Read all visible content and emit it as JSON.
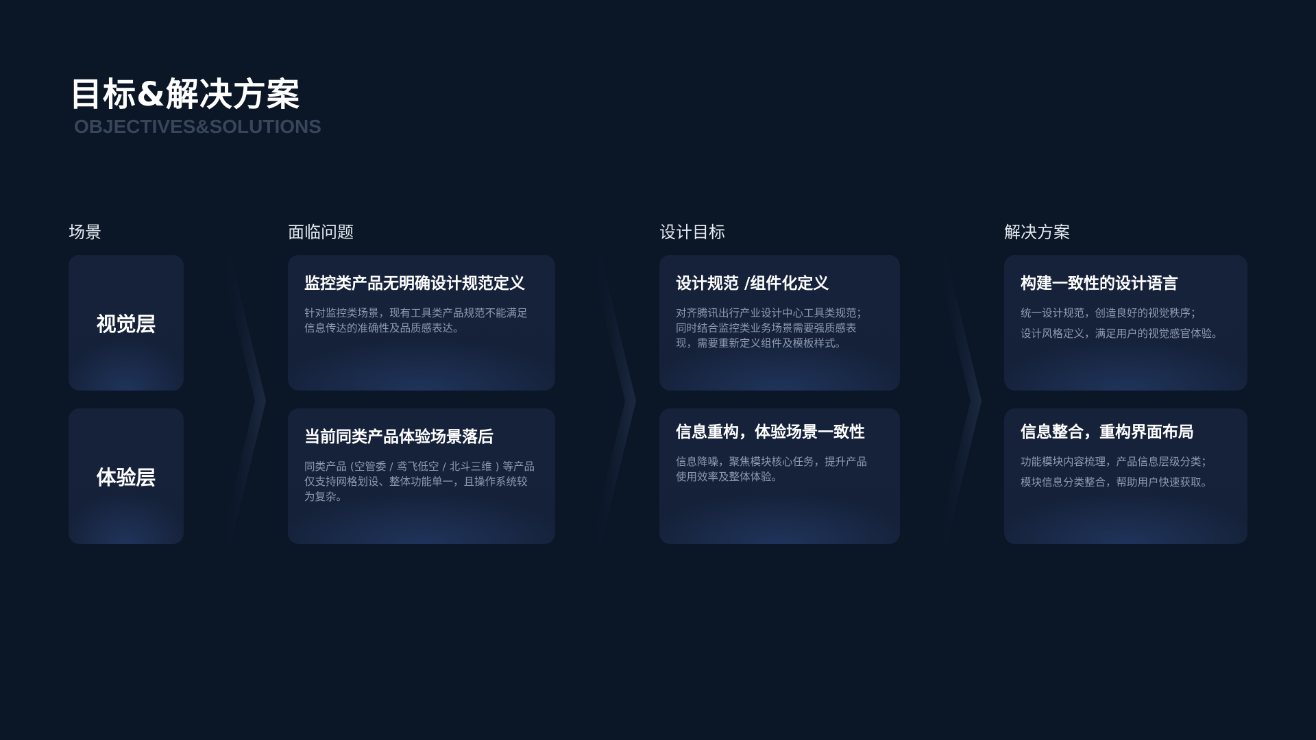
{
  "page": {
    "title": "目标&解决方案",
    "subtitle": "OBJECTIVES&SOLUTIONS"
  },
  "columns": {
    "scene": {
      "header": "场景",
      "items": [
        "视觉层",
        "体验层"
      ]
    },
    "problems": {
      "header": "面临问题",
      "cards": [
        {
          "title": "监控类产品无明确设计规范定义",
          "lines": [
            "针对监控类场景，现有工具类产品规范不能满足",
            "信息传达的准确性及品质感表达。"
          ]
        },
        {
          "title": "当前同类产品体验场景落后",
          "lines": [
            "同类产品 (空管委 / 鸢飞低空 / 北斗三维 ) 等产品",
            "仅支持网格划设、整体功能单一，且操作系统较",
            "为复杂。"
          ]
        }
      ]
    },
    "goals": {
      "header": "设计目标",
      "cards": [
        {
          "title": "设计规范 /组件化定义",
          "lines": [
            "对齐腾讯出行产业设计中心工具类规范；",
            "同时结合监控类业务场景需要强质感表",
            "现，需要重新定义组件及模板样式。"
          ]
        },
        {
          "title": "信息重构，体验场景一致性",
          "lines": [
            "信息降噪，聚焦模块核心任务，提升产品",
            "使用效率及整体体验。"
          ]
        }
      ]
    },
    "solutions": {
      "header": "解决方案",
      "cards": [
        {
          "title": "构建一致性的设计语言",
          "lines": [
            "统一设计规范，创造良好的视觉秩序；",
            "设计风格定义，满足用户的视觉感官体验。"
          ]
        },
        {
          "title": "信息整合，重构界面布局",
          "lines": [
            "功能模块内容梳理，产品信息层级分类；",
            "模块信息分类整合，帮助用户快速获取。"
          ]
        }
      ]
    }
  },
  "colors": {
    "background": "#0b1627",
    "card": "#16223a",
    "card_glow": "#2e4e8a",
    "subtitle": "#38465c",
    "description": "#8e9ab0"
  },
  "icons": [
    "flow-chevron-icon"
  ]
}
